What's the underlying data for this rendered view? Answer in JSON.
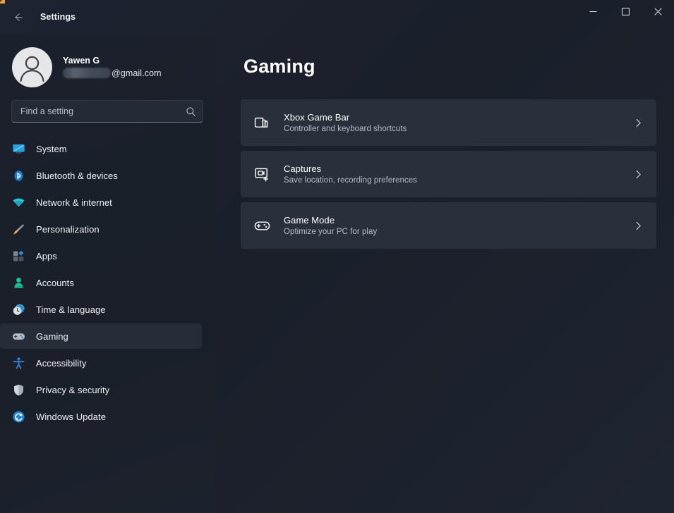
{
  "window": {
    "title": "Settings",
    "back_label": "Back",
    "controls": {
      "minimize": "Minimize",
      "maximize": "Maximize",
      "close": "Close"
    },
    "accent_color": "#f0a63a"
  },
  "account": {
    "name": "Yawen G",
    "email_redacted": true,
    "email_domain": "@gmail.com"
  },
  "search": {
    "placeholder": "Find a setting",
    "value": ""
  },
  "sidebar": {
    "items": [
      {
        "label": "System",
        "icon": "system-icon",
        "selected": false
      },
      {
        "label": "Bluetooth & devices",
        "icon": "bluetooth-icon",
        "selected": false
      },
      {
        "label": "Network & internet",
        "icon": "wifi-icon",
        "selected": false
      },
      {
        "label": "Personalization",
        "icon": "paintbrush-icon",
        "selected": false
      },
      {
        "label": "Apps",
        "icon": "apps-icon",
        "selected": false
      },
      {
        "label": "Accounts",
        "icon": "person-icon",
        "selected": false
      },
      {
        "label": "Time & language",
        "icon": "clock-icon",
        "selected": false
      },
      {
        "label": "Gaming",
        "icon": "gamepad-icon",
        "selected": true
      },
      {
        "label": "Accessibility",
        "icon": "accessibility-icon",
        "selected": false
      },
      {
        "label": "Privacy & security",
        "icon": "shield-icon",
        "selected": false
      },
      {
        "label": "Windows Update",
        "icon": "update-icon",
        "selected": false
      }
    ]
  },
  "main": {
    "title": "Gaming",
    "cards": [
      {
        "title": "Xbox Game Bar",
        "subtitle": "Controller and keyboard shortcuts",
        "icon": "game-bar-icon"
      },
      {
        "title": "Captures",
        "subtitle": "Save location, recording preferences",
        "icon": "capture-icon"
      },
      {
        "title": "Game Mode",
        "subtitle": "Optimize your PC for play",
        "icon": "gamepad-outline-icon"
      }
    ]
  }
}
